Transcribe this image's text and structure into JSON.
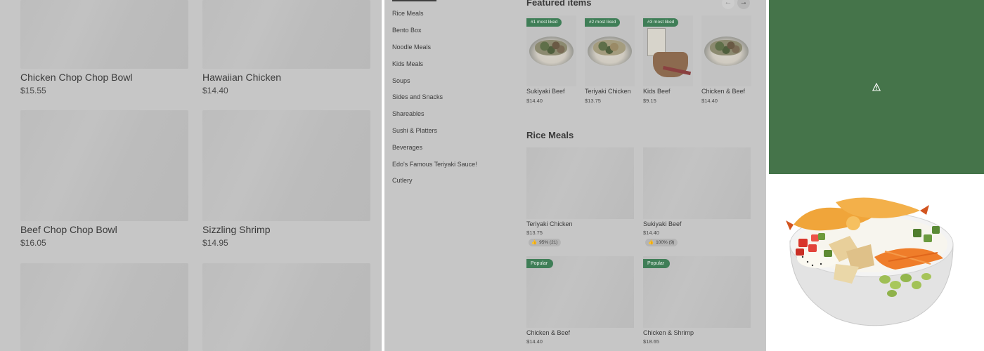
{
  "grid": {
    "items": [
      {
        "name": "Chicken Chop Chop Bowl",
        "price": "$15.55"
      },
      {
        "name": "Hawaiian Chicken",
        "price": "$14.40"
      },
      {
        "name": "Beef Chop Chop Bowl",
        "price": "$16.05"
      },
      {
        "name": "Sizzling Shrimp",
        "price": "$14.95"
      }
    ]
  },
  "menu_nav": {
    "items": [
      "Rice Meals",
      "Bento Box",
      "Noodle Meals",
      "Kids Meals",
      "Soups",
      "Sides and Snacks",
      "Shareables",
      "Sushi & Platters",
      "Beverages",
      "Edo's Famous Teriyaki Sauce!",
      "Cutlery"
    ]
  },
  "featured": {
    "title": "Featured items",
    "prev_icon": "arrow-left-icon",
    "next_icon": "arrow-right-icon",
    "items": [
      {
        "badge": "#1 most liked",
        "name": "Sukiyaki Beef",
        "price": "$14.40"
      },
      {
        "badge": "#2 most liked",
        "name": "Teriyaki Chicken",
        "price": "$13.75"
      },
      {
        "badge": "#3 most liked",
        "name": "Kids Beef",
        "price": "$9.15"
      },
      {
        "badge": "",
        "name": "Chicken & Beef",
        "price": "$14.40"
      }
    ]
  },
  "rice_meals": {
    "title": "Rice Meals",
    "items": [
      {
        "name": "Teriyaki Chicken",
        "price": "$13.75",
        "rating": "95% (21)"
      },
      {
        "name": "Sukiyaki Beef",
        "price": "$14.40",
        "rating": "100% (9)"
      },
      {
        "name": "Chicken & Beef",
        "price": "$14.40",
        "badge": "Popular"
      },
      {
        "name": "Chicken & Shrimp",
        "price": "$18.65",
        "badge": "Popular"
      }
    ]
  },
  "banner": {
    "icon": "warning-icon",
    "color": "#45744a"
  },
  "colors": {
    "badge_green": "#3f7e57",
    "overlay_gray": "#c6c6c6"
  }
}
